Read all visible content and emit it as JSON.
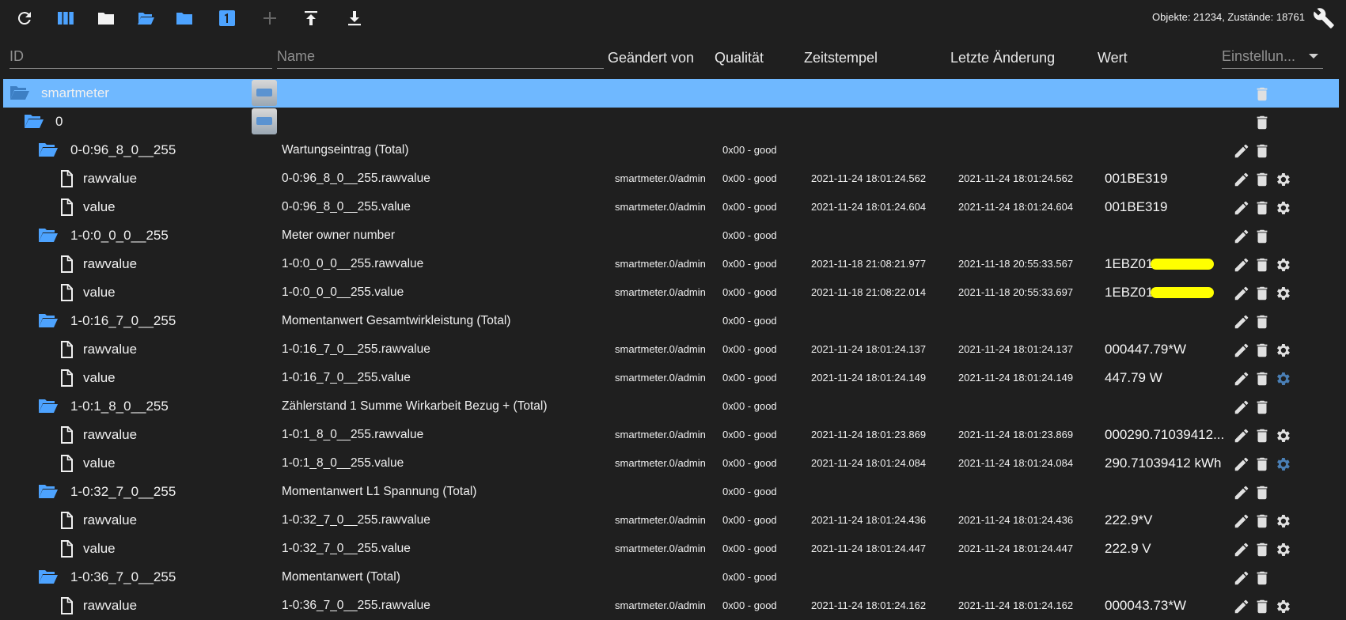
{
  "toolbar": {
    "icons": [
      "refresh-icon",
      "columns-icon",
      "folder-closed-icon",
      "folder-open-icon",
      "folder-icon",
      "one-badge-icon",
      "add-icon",
      "upload-icon",
      "download-icon"
    ],
    "counts": "Objekte: 21234, Zustände: 18761",
    "accent": "#4da3ff"
  },
  "header": {
    "id_placeholder": "ID",
    "name_placeholder": "Name",
    "changed_by": "Geändert von",
    "quality": "Qualität",
    "timestamp": "Zeitstempel",
    "last_change": "Letzte Änderung",
    "value": "Wert",
    "settings": "Einstellun..."
  },
  "rows": [
    {
      "id": "smartmeter",
      "name": "",
      "changed_by": "",
      "quality": "",
      "ts": "",
      "lc": "",
      "value": "",
      "type": "folder",
      "depth": 0
    },
    {
      "id": "0",
      "name": "",
      "changed_by": "",
      "quality": "",
      "ts": "",
      "lc": "",
      "value": "",
      "type": "folder",
      "depth": 1
    },
    {
      "id": "0-0:96_8_0__255",
      "name": "Wartungseintrag (Total)",
      "changed_by": "",
      "quality": "0x00 - good",
      "ts": "",
      "lc": "",
      "value": "",
      "type": "folder",
      "depth": 2
    },
    {
      "id": "rawvalue",
      "name": "0-0:96_8_0__255.rawvalue",
      "changed_by": "smartmeter.0/admin",
      "quality": "0x00 - good",
      "ts": "2021-11-24 18:01:24.562",
      "lc": "2021-11-24 18:01:24.562",
      "value": "001BE319",
      "type": "file",
      "depth": 3
    },
    {
      "id": "value",
      "name": "0-0:96_8_0__255.value",
      "changed_by": "smartmeter.0/admin",
      "quality": "0x00 - good",
      "ts": "2021-11-24 18:01:24.604",
      "lc": "2021-11-24 18:01:24.604",
      "value": "001BE319",
      "type": "file",
      "depth": 3
    },
    {
      "id": "1-0:0_0_0__255",
      "name": "Meter owner number",
      "changed_by": "",
      "quality": "0x00 - good",
      "ts": "",
      "lc": "",
      "value": "",
      "type": "folder",
      "depth": 2
    },
    {
      "id": "rawvalue",
      "name": "1-0:0_0_0__255.rawvalue",
      "changed_by": "smartmeter.0/admin",
      "quality": "0x00 - good",
      "ts": "2021-11-18 21:08:21.977",
      "lc": "2021-11-18 20:55:33.567",
      "value": "1EBZ01",
      "type": "file",
      "depth": 3
    },
    {
      "id": "value",
      "name": "1-0:0_0_0__255.value",
      "changed_by": "smartmeter.0/admin",
      "quality": "0x00 - good",
      "ts": "2021-11-18 21:08:22.014",
      "lc": "2021-11-18 20:55:33.697",
      "value": "1EBZ01",
      "type": "file",
      "depth": 3
    },
    {
      "id": "1-0:16_7_0__255",
      "name": "Momentanwert Gesamtwirkleistung (Total)",
      "changed_by": "",
      "quality": "0x00 - good",
      "ts": "",
      "lc": "",
      "value": "",
      "type": "folder",
      "depth": 2
    },
    {
      "id": "rawvalue",
      "name": "1-0:16_7_0__255.rawvalue",
      "changed_by": "smartmeter.0/admin",
      "quality": "0x00 - good",
      "ts": "2021-11-24 18:01:24.137",
      "lc": "2021-11-24 18:01:24.137",
      "value": "000447.79*W",
      "type": "file",
      "depth": 3
    },
    {
      "id": "value",
      "name": "1-0:16_7_0__255.value",
      "changed_by": "smartmeter.0/admin",
      "quality": "0x00 - good",
      "ts": "2021-11-24 18:01:24.149",
      "lc": "2021-11-24 18:01:24.149",
      "value": "447.79 W",
      "type": "file",
      "depth": 3
    },
    {
      "id": "1-0:1_8_0__255",
      "name": "Zählerstand 1 Summe Wirkarbeit Bezug + (Total)",
      "changed_by": "",
      "quality": "0x00 - good",
      "ts": "",
      "lc": "",
      "value": "",
      "type": "folder",
      "depth": 2
    },
    {
      "id": "rawvalue",
      "name": "1-0:1_8_0__255.rawvalue",
      "changed_by": "smartmeter.0/admin",
      "quality": "0x00 - good",
      "ts": "2021-11-24 18:01:23.869",
      "lc": "2021-11-24 18:01:23.869",
      "value": "000290.71039412...",
      "type": "file",
      "depth": 3
    },
    {
      "id": "value",
      "name": "1-0:1_8_0__255.value",
      "changed_by": "smartmeter.0/admin",
      "quality": "0x00 - good",
      "ts": "2021-11-24 18:01:24.084",
      "lc": "2021-11-24 18:01:24.084",
      "value": "290.71039412 kWh",
      "type": "file",
      "depth": 3
    },
    {
      "id": "1-0:32_7_0__255",
      "name": "Momentanwert L1 Spannung (Total)",
      "changed_by": "",
      "quality": "0x00 - good",
      "ts": "",
      "lc": "",
      "value": "",
      "type": "folder",
      "depth": 2
    },
    {
      "id": "rawvalue",
      "name": "1-0:32_7_0__255.rawvalue",
      "changed_by": "smartmeter.0/admin",
      "quality": "0x00 - good",
      "ts": "2021-11-24 18:01:24.436",
      "lc": "2021-11-24 18:01:24.436",
      "value": "222.9*V",
      "type": "file",
      "depth": 3
    },
    {
      "id": "value",
      "name": "1-0:32_7_0__255.value",
      "changed_by": "smartmeter.0/admin",
      "quality": "0x00 - good",
      "ts": "2021-11-24 18:01:24.447",
      "lc": "2021-11-24 18:01:24.447",
      "value": "222.9 V",
      "type": "file",
      "depth": 3
    },
    {
      "id": "1-0:36_7_0__255",
      "name": "Momentanwert (Total)",
      "changed_by": "",
      "quality": "0x00 - good",
      "ts": "",
      "lc": "",
      "value": "",
      "type": "folder",
      "depth": 2
    },
    {
      "id": "rawvalue",
      "name": "1-0:36_7_0__255.rawvalue",
      "changed_by": "smartmeter.0/admin",
      "quality": "0x00 - good",
      "ts": "2021-11-24 18:01:24.162",
      "lc": "2021-11-24 18:01:24.162",
      "value": "000043.73*W",
      "type": "file",
      "depth": 3
    }
  ]
}
